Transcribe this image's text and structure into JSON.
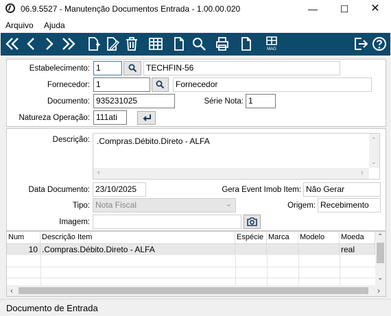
{
  "window": {
    "title": "06.9.5527 - Manutenção Documentos Entrada - 1.00.00.020"
  },
  "menu": {
    "items": [
      "Arquivo",
      "Ajuda"
    ]
  },
  "form": {
    "estabelecimento": {
      "label": "Estabelecimento:",
      "code": "1",
      "name": "TECHFIN-56"
    },
    "fornecedor": {
      "label": "Fornecedor:",
      "code": "1",
      "name": "Fornecedor"
    },
    "documento": {
      "label": "Documento:",
      "value": "935231025"
    },
    "serie_nota": {
      "label": "Série Nota:",
      "value": "1"
    },
    "natureza": {
      "label": "Natureza Operação:",
      "value": "111ati"
    },
    "descricao": {
      "label": "Descrição:",
      "value": ".Compras.Débito.Direto - ALFA"
    },
    "data_documento": {
      "label": "Data Documento:",
      "value": "23/10/2025"
    },
    "gera_event": {
      "label": "Gera Event Imob Item:",
      "value": "Não Gerar"
    },
    "tipo": {
      "label": "Tipo:",
      "value": "Nota Fiscal"
    },
    "origem": {
      "label": "Origem:",
      "value": "Recebimento"
    },
    "imagem": {
      "label": "Imagem:",
      "value": ""
    }
  },
  "table": {
    "columns": [
      "Num Item",
      "Descrição Item",
      "Espécie",
      "Marca",
      "Modelo",
      "Moeda"
    ],
    "rows": [
      {
        "num_item": "10",
        "descricao": ".Compras.Débito.Direto - ALFA",
        "especie": "",
        "marca": "",
        "modelo": "",
        "moeda": "real"
      }
    ]
  },
  "status": {
    "text": "Documento de Entrada"
  },
  "toolbar": {
    "left_icons": [
      "first-record-icon",
      "previous-record-icon",
      "next-record-icon",
      "last-record-icon",
      "new-document-icon",
      "edit-document-icon",
      "delete-icon",
      "grid-icon",
      "blank-document-icon",
      "search-icon",
      "print-icon",
      "copy-document-icon",
      "mag-icon"
    ],
    "mag_label": "MAG",
    "right_icons": [
      "exit-icon",
      "help-icon"
    ]
  },
  "colors": {
    "toolbar": "#0e4a6c",
    "selection_row": "#e8e8e8"
  }
}
